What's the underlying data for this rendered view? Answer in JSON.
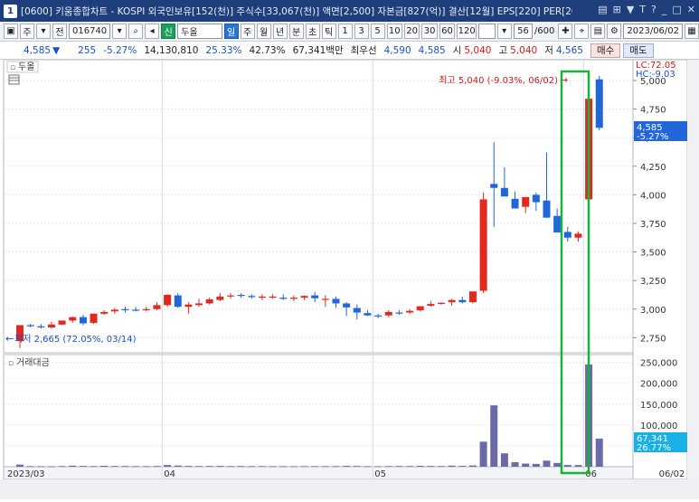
{
  "window": {
    "number": "1",
    "title": "[0600] 키움종합차트 - KOSPI 외국인보유[152(천)] 주식수[33,067(천)] 액면[2,500] 자본금[827(억)] 결산[12월] EPS[220] PER[20"
  },
  "toolbar": {
    "mode_1": "주",
    "mode_2": "전",
    "code": "016740",
    "credit_badge": "신",
    "name": "두올",
    "periods": [
      "일",
      "주",
      "월",
      "년",
      "분",
      "초",
      "틱"
    ],
    "active_period": "일",
    "intervals": [
      "1",
      "3",
      "5",
      "10",
      "20",
      "30",
      "60",
      "120"
    ],
    "count": "56",
    "count_max": "/600",
    "date": "2023/06/02"
  },
  "quote": {
    "price": "4,585",
    "change": "255",
    "change_pct": "-5.27%",
    "volume": "14,130,810",
    "turnover_rate": "25.33%",
    "ratio": "42.73%",
    "amount": "67,341백만",
    "best_label": "최우선",
    "bid": "4,590",
    "ask": "4,585",
    "open_label": "시",
    "open": "5,040",
    "high_label": "고",
    "high": "5,040",
    "low_label": "저",
    "low": "4,565",
    "buy_button": "매수",
    "sell_button": "매도"
  },
  "price_pane": {
    "label": "두올",
    "limit_up": "LC:72.05",
    "limit_down": "HC:-9.03",
    "current_tag": "4,585",
    "current_pct": "-5.27%",
    "high_note": "최고 5,040 (-9.03%, 06/02)",
    "low_note": "최저 2,665 (72.05%, 03/14)",
    "y_ticks": [
      "5,000",
      "4,750",
      "4,500",
      "4,250",
      "4,000",
      "3,750",
      "3,500",
      "3,250",
      "3,000",
      "2,750"
    ]
  },
  "volume_pane": {
    "label": "거래대금",
    "y_ticks": [
      "250,000",
      "200,000",
      "150,000",
      "100,000",
      "50,000"
    ],
    "current_tag": "67,341",
    "current_pct": "26.77%"
  },
  "x_axis": {
    "labels": [
      "2023/03",
      "04",
      "05",
      "06"
    ],
    "end_label": "06/02"
  },
  "colors": {
    "up": "#e3281f",
    "down": "#2266d8",
    "volume": "#6a6aa8",
    "highlight": "#19b33a"
  },
  "chart_data": {
    "type": "candlestick",
    "x": [
      "03/14",
      "03/15",
      "03/16",
      "03/17",
      "03/20",
      "03/21",
      "03/22",
      "03/23",
      "03/24",
      "03/27",
      "03/28",
      "03/29",
      "03/30",
      "03/31",
      "04/03",
      "04/04",
      "04/05",
      "04/06",
      "04/07",
      "04/10",
      "04/11",
      "04/12",
      "04/13",
      "04/14",
      "04/17",
      "04/18",
      "04/19",
      "04/20",
      "04/21",
      "04/24",
      "04/25",
      "04/26",
      "04/27",
      "04/28",
      "05/02",
      "05/03",
      "05/04",
      "05/08",
      "05/09",
      "05/10",
      "05/11",
      "05/12",
      "05/15",
      "05/16",
      "05/17",
      "05/18",
      "05/19",
      "05/22",
      "05/23",
      "05/24",
      "05/25",
      "05/26",
      "05/30",
      "05/31",
      "06/01",
      "06/02"
    ],
    "open": [
      2720,
      2860,
      2850,
      2840,
      2865,
      2900,
      2930,
      2880,
      2960,
      2980,
      3000,
      2995,
      3000,
      3000,
      3035,
      3120,
      3020,
      3035,
      3050,
      3080,
      3115,
      3125,
      3115,
      3100,
      3110,
      3100,
      3090,
      3100,
      3120,
      3090,
      3090,
      3050,
      3010,
      2965,
      2945,
      2945,
      2970,
      2970,
      2990,
      3030,
      3045,
      3060,
      3080,
      3060,
      3160,
      4095,
      4060,
      3965,
      3895,
      4000,
      3950,
      3815,
      3675,
      3625,
      3960,
      5010
    ],
    "high": [
      2730,
      2870,
      2870,
      2890,
      2890,
      2935,
      2950,
      2960,
      2990,
      3010,
      3020,
      3020,
      3020,
      3060,
      3130,
      3140,
      3060,
      3090,
      3100,
      3140,
      3140,
      3140,
      3130,
      3130,
      3130,
      3130,
      3120,
      3120,
      3150,
      3120,
      3110,
      3060,
      3040,
      2990,
      2960,
      2990,
      2990,
      3000,
      3020,
      3070,
      3060,
      3090,
      3110,
      3110,
      4020,
      4460,
      4240,
      4030,
      3960,
      4020,
      4370,
      3880,
      3720,
      3680,
      4880,
      5040
    ],
    "low": [
      2660,
      2840,
      2830,
      2830,
      2860,
      2880,
      2860,
      2870,
      2950,
      2960,
      2970,
      2980,
      2980,
      2990,
      3020,
      3010,
      2960,
      3020,
      3040,
      3070,
      3090,
      3100,
      3090,
      3080,
      3090,
      3080,
      3070,
      3080,
      3060,
      3020,
      3010,
      2940,
      2910,
      2940,
      2920,
      2930,
      2950,
      2960,
      2980,
      3020,
      3040,
      3030,
      3050,
      3050,
      3140,
      3720,
      4000,
      3920,
      3840,
      3860,
      3800,
      3700,
      3590,
      3590,
      3900,
      4565
    ],
    "close": [
      2860,
      2850,
      2840,
      2865,
      2900,
      2930,
      2875,
      2960,
      2975,
      2995,
      2995,
      2990,
      3000,
      3035,
      3125,
      3020,
      3040,
      3050,
      3085,
      3110,
      3120,
      3115,
      3105,
      3110,
      3110,
      3090,
      3100,
      3115,
      3095,
      3090,
      3050,
      3015,
      2970,
      2945,
      2940,
      2975,
      2965,
      2985,
      3025,
      3045,
      3055,
      3080,
      3060,
      3155,
      3960,
      4060,
      3985,
      3880,
      3980,
      3935,
      3800,
      3670,
      3625,
      3660,
      4840,
      4585
    ],
    "volume_amount": [
      5000,
      1400,
      1200,
      1000,
      1600,
      2500,
      1900,
      1500,
      2200,
      1700,
      1600,
      1400,
      1300,
      1600,
      4000,
      2800,
      1900,
      1700,
      1800,
      1900,
      1500,
      1600,
      1400,
      1500,
      1300,
      1300,
      1200,
      1300,
      1500,
      1400,
      1500,
      2000,
      1800,
      1300,
      1200,
      1500,
      1700,
      1600,
      2200,
      1900,
      1600,
      2600,
      2000,
      3000,
      60000,
      147000,
      32000,
      11000,
      7500,
      6800,
      14500,
      9000,
      4200,
      3900,
      245000,
      67341
    ],
    "ylim_price": [
      2650,
      5150
    ],
    "ylim_volume": [
      0,
      260000
    ]
  }
}
